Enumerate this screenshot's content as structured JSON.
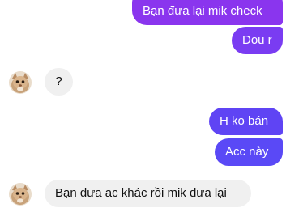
{
  "conversation": {
    "messages": [
      {
        "from": "me",
        "text": "Bạn đưa lại mik check"
      },
      {
        "from": "me",
        "text": "Dou r"
      },
      {
        "from": "contact",
        "text": "?"
      },
      {
        "from": "me",
        "text": "H ko bán"
      },
      {
        "from": "me",
        "text": "Acc này"
      },
      {
        "from": "contact",
        "text": "Bạn đưa ac khác rồi mik đưa lại"
      }
    ]
  },
  "colors": {
    "sent_bubble": "#6a3df3",
    "received_bubble": "#f0f0f0",
    "sent_text": "#ffffff",
    "received_text": "#111111"
  },
  "icons": {
    "contact_avatar": "cat-avatar-icon"
  }
}
